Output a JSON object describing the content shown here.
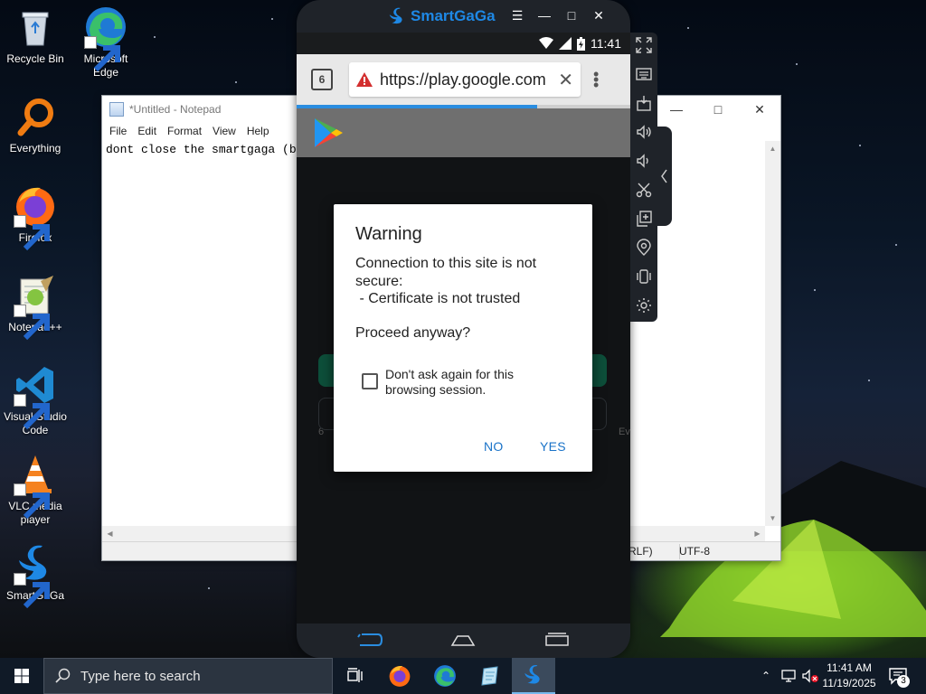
{
  "desktop": {
    "icons": [
      {
        "label": "Recycle Bin"
      },
      {
        "label": "Microsoft Edge"
      },
      {
        "label": "Everything"
      },
      {
        "label": "Firefox"
      },
      {
        "label": "Notepad++"
      },
      {
        "label": "Visual Studio Code"
      },
      {
        "label": "VLC media player"
      },
      {
        "label": "SmartGaGa"
      }
    ]
  },
  "notepad": {
    "title": "*Untitled - Notepad",
    "menu": [
      "File",
      "Edit",
      "Format",
      "View",
      "Help"
    ],
    "content": "dont close the smartgaga (b",
    "status_line_ending": "RLF)",
    "status_encoding": "UTF-8"
  },
  "smartgaga": {
    "brand": "SmartGaGa",
    "status_time": "11:41",
    "browser": {
      "tab_count": "6",
      "url": "https://play.google.com",
      "progress": 0.72
    },
    "background_text_left": "6",
    "background_text_right": "Ev",
    "dialog": {
      "title": "Warning",
      "message_line1": "Connection to this site is not",
      "message_line2": "secure:",
      "message_line3": " - Certificate is not trusted",
      "proceed": "Proceed anyway?",
      "checkbox_label": "Don't ask again for this browsing session.",
      "checkbox_checked": false,
      "no_label": "NO",
      "yes_label": "YES"
    }
  },
  "taskbar": {
    "search_placeholder": "Type here to search",
    "time": "11:41 AM",
    "date": "11/19/2025",
    "notification_count": "3"
  },
  "colors": {
    "accent": "#1a73c8",
    "brand": "#1e88e5",
    "warning": "#d32f2f"
  }
}
